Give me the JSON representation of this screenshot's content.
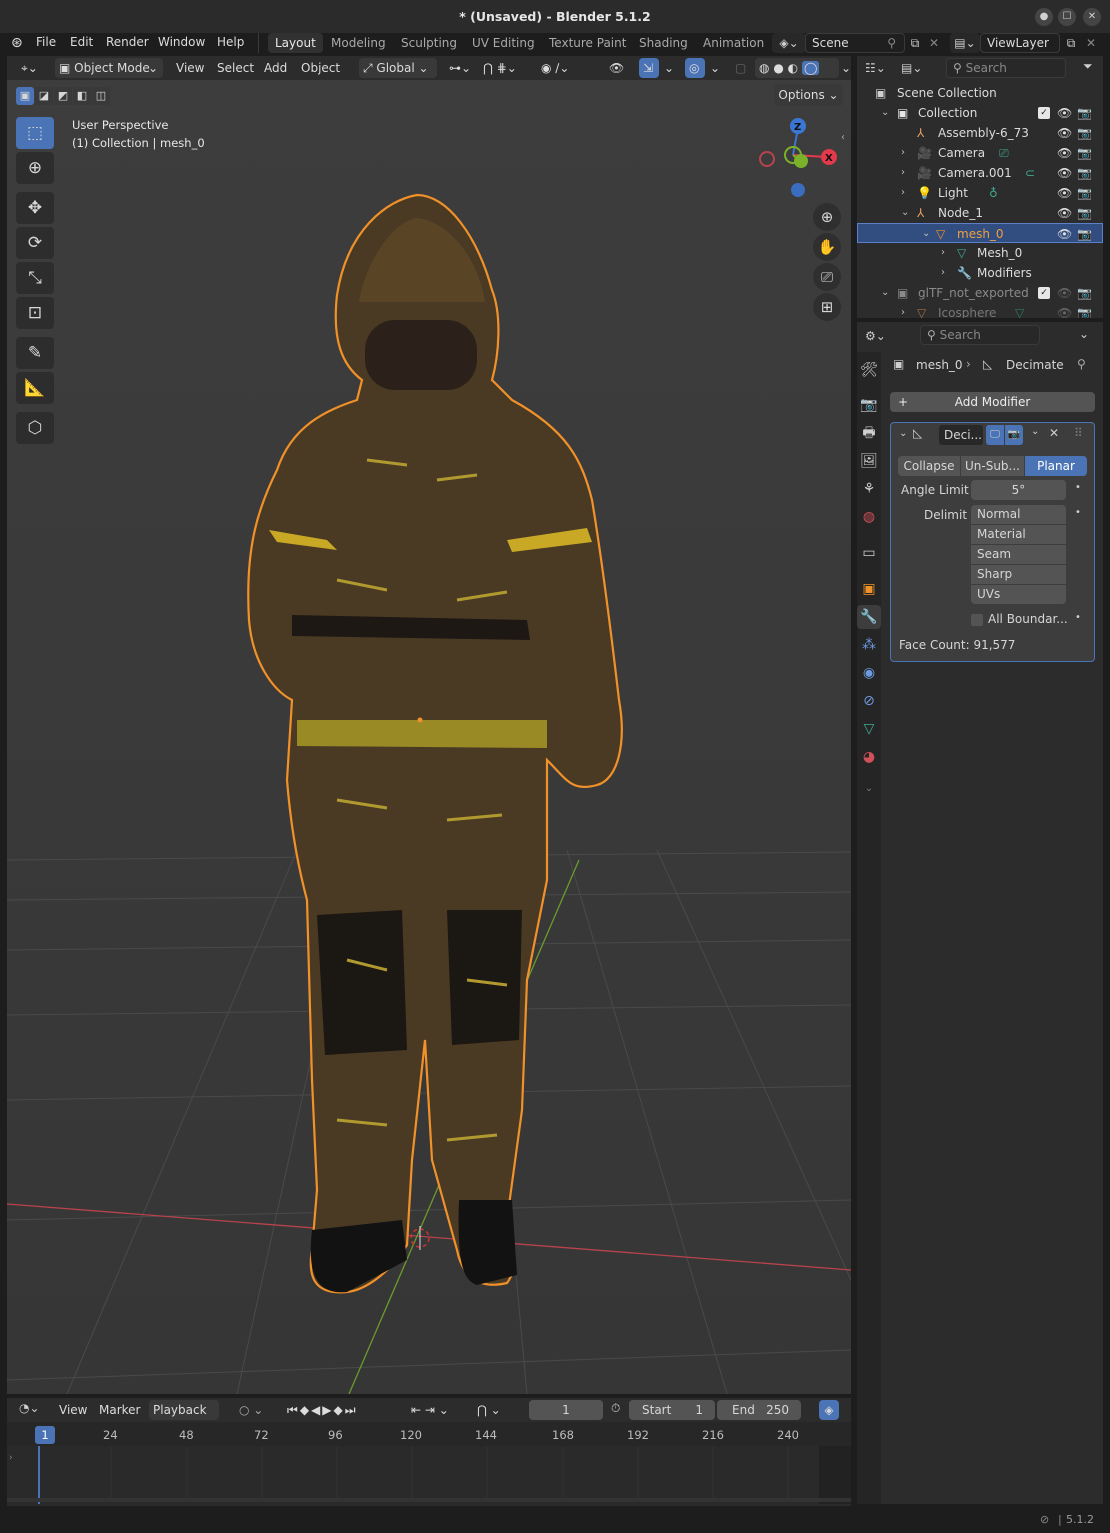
{
  "window": {
    "title": "* (Unsaved) - Blender 5.1.2"
  },
  "menus": [
    "File",
    "Edit",
    "Render",
    "Window",
    "Help"
  ],
  "workspaces": [
    "Layout",
    "Modeling",
    "Sculpting",
    "UV Editing",
    "Texture Paint",
    "Shading",
    "Animation"
  ],
  "scene": {
    "name": "Scene",
    "view_layer": "ViewLayer"
  },
  "viewport_header": {
    "mode": "Object Mode",
    "menus": [
      "View",
      "Select",
      "Add",
      "Object"
    ],
    "orientation": "Global",
    "options": "Options"
  },
  "viewport": {
    "perspective": "User Perspective",
    "context": "(1) Collection | mesh_0"
  },
  "gizmo": {
    "z": "Z",
    "x": "X"
  },
  "outliner": {
    "search_placeholder": "Search",
    "rows": [
      {
        "label": "Scene Collection"
      },
      {
        "label": "Collection"
      },
      {
        "label": "Assembly-6_73"
      },
      {
        "label": "Camera"
      },
      {
        "label": "Camera.001"
      },
      {
        "label": "Light"
      },
      {
        "label": "Node_1"
      },
      {
        "label": "mesh_0"
      },
      {
        "label": "Mesh_0"
      },
      {
        "label": "Modifiers"
      },
      {
        "label": "glTF_not_exported"
      },
      {
        "label": "Icosphere"
      }
    ]
  },
  "properties": {
    "search_placeholder": "Search",
    "breadcrumb_object": "mesh_0",
    "breadcrumb_modifier": "Decimate",
    "add_modifier": "Add Modifier",
    "modifier_name": "Deci...",
    "modes": [
      "Collapse",
      "Un-Sub...",
      "Planar"
    ],
    "active_mode": "Planar",
    "angle_limit_label": "Angle Limit",
    "angle_limit_value": "5°",
    "delimit_label": "Delimit",
    "delimit_options": [
      "Normal",
      "Material",
      "Seam",
      "Sharp",
      "UVs"
    ],
    "delimit_selected": "Normal",
    "all_boundaries": "All Boundar...",
    "face_count": "Face Count: 91,577"
  },
  "timeline": {
    "menus": [
      "View",
      "Marker",
      "Playback"
    ],
    "current_frame": "1",
    "start_label": "Start",
    "start": "1",
    "end_label": "End",
    "end": "250",
    "ruler": [
      "1",
      "24",
      "48",
      "72",
      "96",
      "120",
      "144",
      "168",
      "192",
      "216",
      "240"
    ]
  },
  "status": {
    "version": "5.1.2"
  },
  "colors": {
    "accent": "#4b74b6",
    "selection": "#f39a32",
    "x_axis": "#e4384b",
    "y_axis": "#7bb22a",
    "z_axis": "#3a77d4"
  }
}
